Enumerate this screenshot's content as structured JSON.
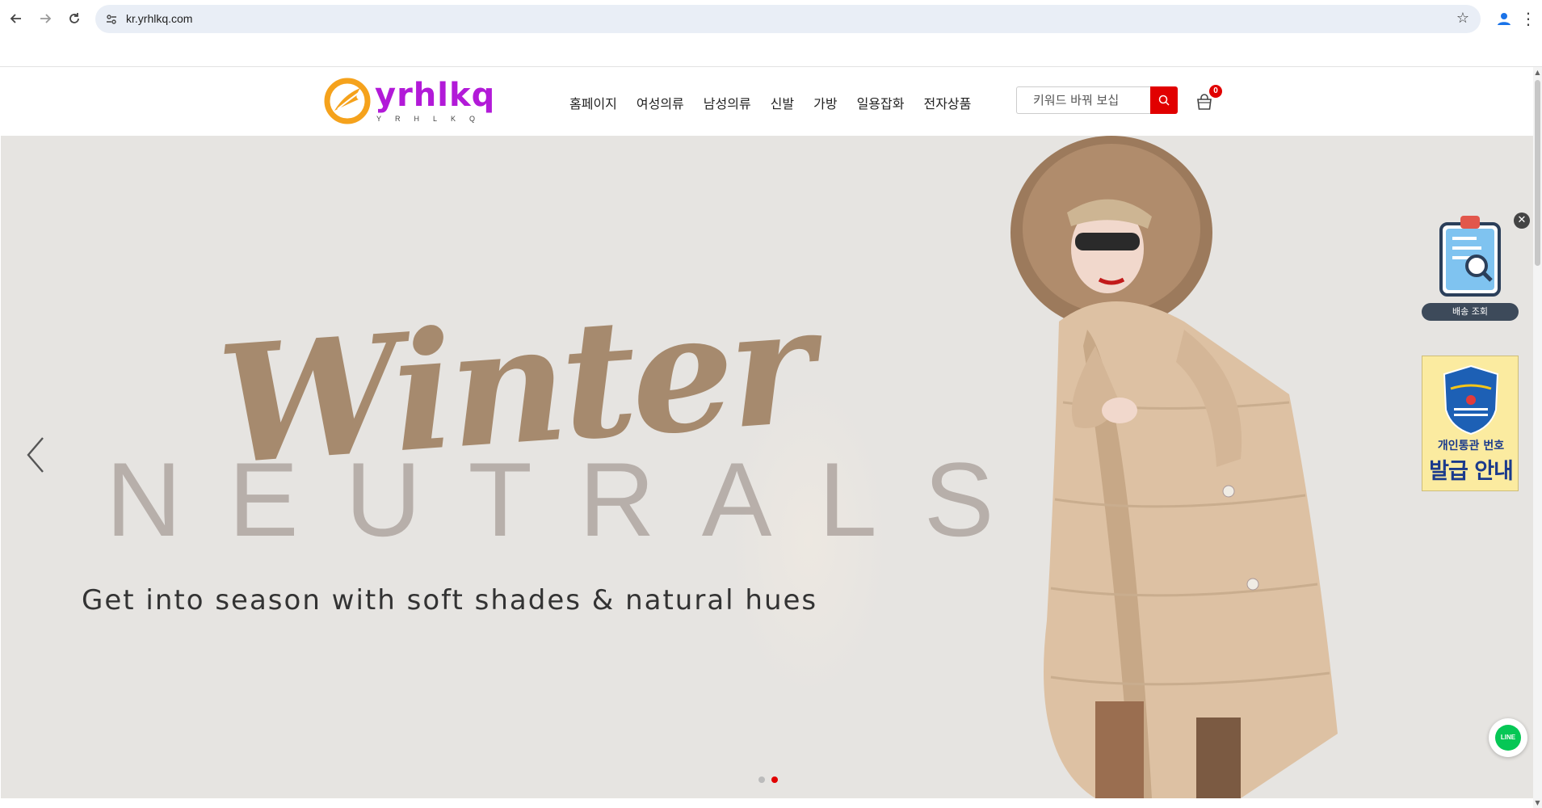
{
  "browser": {
    "url": "kr.yrhlkq.com",
    "icons": [
      "back-icon",
      "forward-icon",
      "reload-icon",
      "site-settings-icon",
      "bookmark-star-icon",
      "profile-icon",
      "menu-icon"
    ]
  },
  "header": {
    "logo_text": "yrhlkq",
    "logo_sub": "YRHLKQ",
    "nav": [
      "홈페이지",
      "여성의류",
      "남성의류",
      "신발",
      "가방",
      "일용잡화",
      "전자상품"
    ],
    "search_placeholder": "키워드 바꿔 보십",
    "cart_count": "0"
  },
  "hero": {
    "title_script": "Winter",
    "title_caps": "NEUTRALS",
    "tagline": "Get into season with soft shades & natural hues",
    "slides_total": 2,
    "active_slide": 2
  },
  "widgets": {
    "tracking_label": "배송 조회",
    "close_glyph": "✕",
    "customs_line1": "개인통관 번호",
    "customs_line2": "발급 안내",
    "line_label": "LINE"
  },
  "colors": {
    "accent_red": "#e10000",
    "logo_purple": "#b21ad8",
    "logo_orange": "#f5a21c",
    "hero_bg": "#e6e4e1"
  }
}
